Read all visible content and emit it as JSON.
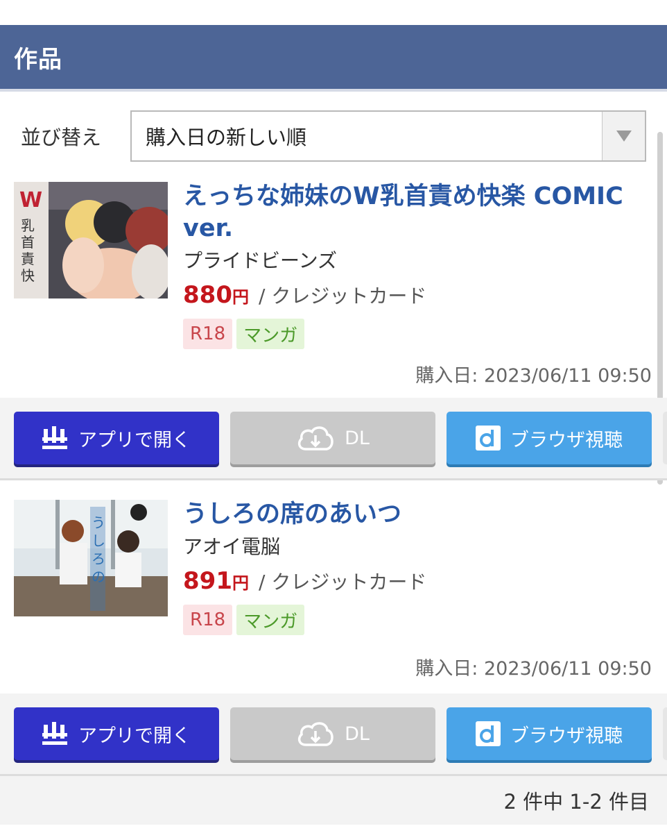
{
  "header": {
    "title": "作品"
  },
  "sort": {
    "label": "並び替え",
    "selected": "購入日の新しい順"
  },
  "products": [
    {
      "title": "えっちな姉妹のW乳首責め快楽 COMIC ver.",
      "circle": "プライドビーンズ",
      "price": "880",
      "currency": "円",
      "payment": "/ クレジットカード",
      "tags": [
        "R18",
        "マンガ"
      ],
      "purchase_date": "購入日: 2023/06/11 09:50",
      "buttons": {
        "app": "アプリで開く",
        "dl": "DL",
        "browser": "ブラウザ視聴"
      }
    },
    {
      "title": "うしろの席のあいつ",
      "circle": "アオイ電脳",
      "price": "891",
      "currency": "円",
      "payment": "/ クレジットカード",
      "tags": [
        "R18",
        "マンガ"
      ],
      "purchase_date": "購入日: 2023/06/11 09:50",
      "buttons": {
        "app": "アプリで開く",
        "dl": "DL",
        "browser": "ブラウザ視聴"
      }
    }
  ],
  "pager": {
    "text": "2 件中 1-2 件目"
  },
  "colors": {
    "header": "#4d6596",
    "title_link": "#2857a4",
    "price": "#c4161c",
    "app_button": "#3132c8",
    "browser_button": "#4aa4e8",
    "dl_button_disabled": "#c9c9c9"
  },
  "icons": {
    "sort_arrow": "triangle-down-icon",
    "app": "app-logo-icon",
    "dl": "cloud-download-icon",
    "browser": "browser-d-icon"
  }
}
